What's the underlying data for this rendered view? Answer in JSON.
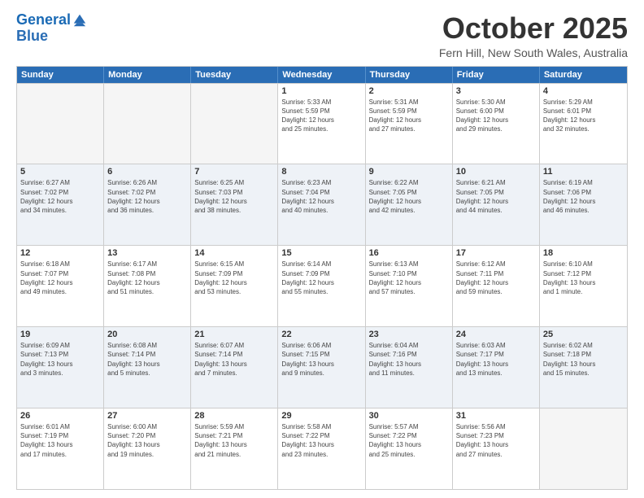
{
  "logo": {
    "line1": "General",
    "line2": "Blue"
  },
  "title": "October 2025",
  "location": "Fern Hill, New South Wales, Australia",
  "days_of_week": [
    "Sunday",
    "Monday",
    "Tuesday",
    "Wednesday",
    "Thursday",
    "Friday",
    "Saturday"
  ],
  "weeks": [
    {
      "alt": false,
      "cells": [
        {
          "day": "",
          "empty": true,
          "info": ""
        },
        {
          "day": "",
          "empty": true,
          "info": ""
        },
        {
          "day": "",
          "empty": true,
          "info": ""
        },
        {
          "day": "1",
          "empty": false,
          "info": "Sunrise: 5:33 AM\nSunset: 5:59 PM\nDaylight: 12 hours\nand 25 minutes."
        },
        {
          "day": "2",
          "empty": false,
          "info": "Sunrise: 5:31 AM\nSunset: 5:59 PM\nDaylight: 12 hours\nand 27 minutes."
        },
        {
          "day": "3",
          "empty": false,
          "info": "Sunrise: 5:30 AM\nSunset: 6:00 PM\nDaylight: 12 hours\nand 29 minutes."
        },
        {
          "day": "4",
          "empty": false,
          "info": "Sunrise: 5:29 AM\nSunset: 6:01 PM\nDaylight: 12 hours\nand 32 minutes."
        }
      ]
    },
    {
      "alt": true,
      "cells": [
        {
          "day": "5",
          "empty": false,
          "info": "Sunrise: 6:27 AM\nSunset: 7:02 PM\nDaylight: 12 hours\nand 34 minutes."
        },
        {
          "day": "6",
          "empty": false,
          "info": "Sunrise: 6:26 AM\nSunset: 7:02 PM\nDaylight: 12 hours\nand 36 minutes."
        },
        {
          "day": "7",
          "empty": false,
          "info": "Sunrise: 6:25 AM\nSunset: 7:03 PM\nDaylight: 12 hours\nand 38 minutes."
        },
        {
          "day": "8",
          "empty": false,
          "info": "Sunrise: 6:23 AM\nSunset: 7:04 PM\nDaylight: 12 hours\nand 40 minutes."
        },
        {
          "day": "9",
          "empty": false,
          "info": "Sunrise: 6:22 AM\nSunset: 7:05 PM\nDaylight: 12 hours\nand 42 minutes."
        },
        {
          "day": "10",
          "empty": false,
          "info": "Sunrise: 6:21 AM\nSunset: 7:05 PM\nDaylight: 12 hours\nand 44 minutes."
        },
        {
          "day": "11",
          "empty": false,
          "info": "Sunrise: 6:19 AM\nSunset: 7:06 PM\nDaylight: 12 hours\nand 46 minutes."
        }
      ]
    },
    {
      "alt": false,
      "cells": [
        {
          "day": "12",
          "empty": false,
          "info": "Sunrise: 6:18 AM\nSunset: 7:07 PM\nDaylight: 12 hours\nand 49 minutes."
        },
        {
          "day": "13",
          "empty": false,
          "info": "Sunrise: 6:17 AM\nSunset: 7:08 PM\nDaylight: 12 hours\nand 51 minutes."
        },
        {
          "day": "14",
          "empty": false,
          "info": "Sunrise: 6:15 AM\nSunset: 7:09 PM\nDaylight: 12 hours\nand 53 minutes."
        },
        {
          "day": "15",
          "empty": false,
          "info": "Sunrise: 6:14 AM\nSunset: 7:09 PM\nDaylight: 12 hours\nand 55 minutes."
        },
        {
          "day": "16",
          "empty": false,
          "info": "Sunrise: 6:13 AM\nSunset: 7:10 PM\nDaylight: 12 hours\nand 57 minutes."
        },
        {
          "day": "17",
          "empty": false,
          "info": "Sunrise: 6:12 AM\nSunset: 7:11 PM\nDaylight: 12 hours\nand 59 minutes."
        },
        {
          "day": "18",
          "empty": false,
          "info": "Sunrise: 6:10 AM\nSunset: 7:12 PM\nDaylight: 13 hours\nand 1 minute."
        }
      ]
    },
    {
      "alt": true,
      "cells": [
        {
          "day": "19",
          "empty": false,
          "info": "Sunrise: 6:09 AM\nSunset: 7:13 PM\nDaylight: 13 hours\nand 3 minutes."
        },
        {
          "day": "20",
          "empty": false,
          "info": "Sunrise: 6:08 AM\nSunset: 7:14 PM\nDaylight: 13 hours\nand 5 minutes."
        },
        {
          "day": "21",
          "empty": false,
          "info": "Sunrise: 6:07 AM\nSunset: 7:14 PM\nDaylight: 13 hours\nand 7 minutes."
        },
        {
          "day": "22",
          "empty": false,
          "info": "Sunrise: 6:06 AM\nSunset: 7:15 PM\nDaylight: 13 hours\nand 9 minutes."
        },
        {
          "day": "23",
          "empty": false,
          "info": "Sunrise: 6:04 AM\nSunset: 7:16 PM\nDaylight: 13 hours\nand 11 minutes."
        },
        {
          "day": "24",
          "empty": false,
          "info": "Sunrise: 6:03 AM\nSunset: 7:17 PM\nDaylight: 13 hours\nand 13 minutes."
        },
        {
          "day": "25",
          "empty": false,
          "info": "Sunrise: 6:02 AM\nSunset: 7:18 PM\nDaylight: 13 hours\nand 15 minutes."
        }
      ]
    },
    {
      "alt": false,
      "cells": [
        {
          "day": "26",
          "empty": false,
          "info": "Sunrise: 6:01 AM\nSunset: 7:19 PM\nDaylight: 13 hours\nand 17 minutes."
        },
        {
          "day": "27",
          "empty": false,
          "info": "Sunrise: 6:00 AM\nSunset: 7:20 PM\nDaylight: 13 hours\nand 19 minutes."
        },
        {
          "day": "28",
          "empty": false,
          "info": "Sunrise: 5:59 AM\nSunset: 7:21 PM\nDaylight: 13 hours\nand 21 minutes."
        },
        {
          "day": "29",
          "empty": false,
          "info": "Sunrise: 5:58 AM\nSunset: 7:22 PM\nDaylight: 13 hours\nand 23 minutes."
        },
        {
          "day": "30",
          "empty": false,
          "info": "Sunrise: 5:57 AM\nSunset: 7:22 PM\nDaylight: 13 hours\nand 25 minutes."
        },
        {
          "day": "31",
          "empty": false,
          "info": "Sunrise: 5:56 AM\nSunset: 7:23 PM\nDaylight: 13 hours\nand 27 minutes."
        },
        {
          "day": "",
          "empty": true,
          "info": ""
        }
      ]
    }
  ]
}
